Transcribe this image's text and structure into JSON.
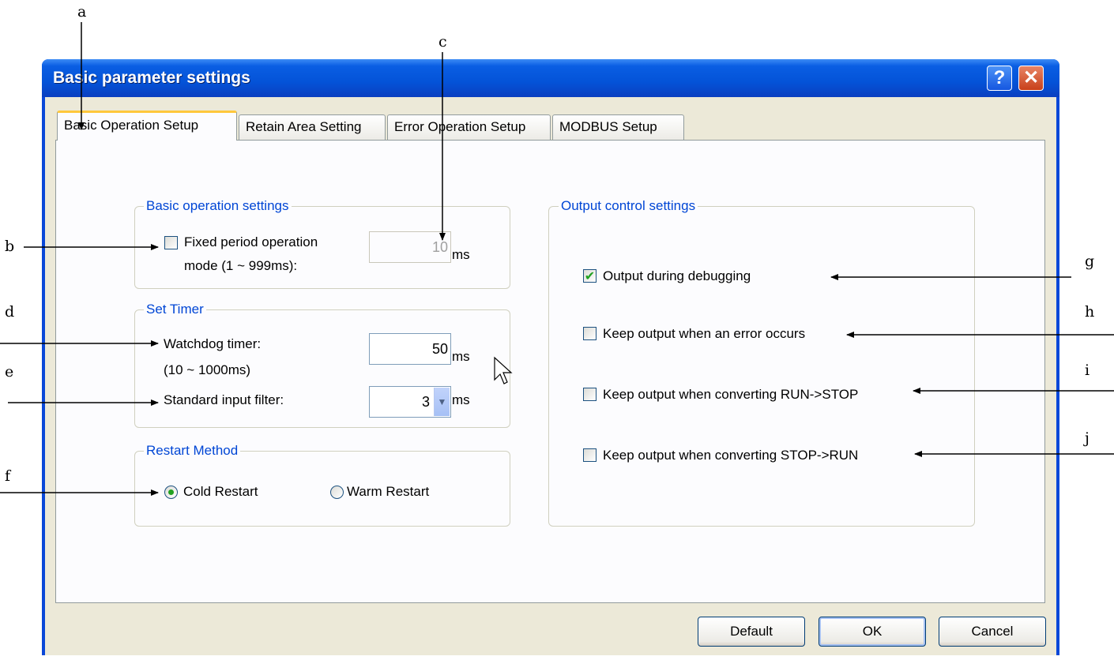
{
  "window": {
    "title": "Basic parameter settings",
    "help_glyph": "?",
    "close_glyph": "✕"
  },
  "tabs": [
    {
      "label": "Basic Operation Setup",
      "active": true
    },
    {
      "label": "Retain Area Setting"
    },
    {
      "label": "Error Operation Setup"
    },
    {
      "label": "MODBUS Setup"
    }
  ],
  "basic_operation": {
    "legend": "Basic operation settings",
    "fixed_period_label_1": "Fixed period operation",
    "fixed_period_label_2": "mode (1 ~ 999ms):",
    "fixed_period_checked": false,
    "fixed_period_value": "10",
    "unit": "ms"
  },
  "set_timer": {
    "legend": "Set Timer",
    "watchdog_label_1": "Watchdog timer:",
    "watchdog_label_2": "(10 ~ 1000ms)",
    "watchdog_value": "50",
    "filter_label": "Standard input filter:",
    "filter_value": "3",
    "unit": "ms"
  },
  "restart": {
    "legend": "Restart Method",
    "cold_label": "Cold Restart",
    "warm_label": "Warm Restart",
    "selected": "cold"
  },
  "output_control": {
    "legend": "Output control settings",
    "items": [
      {
        "label": "Output during debugging",
        "checked": true
      },
      {
        "label": "Keep output when an error occurs",
        "checked": false
      },
      {
        "label": "Keep output when converting RUN->STOP",
        "checked": false
      },
      {
        "label": "Keep output when converting STOP->RUN",
        "checked": false
      }
    ]
  },
  "buttons": {
    "default_label": "Default",
    "ok_label": "OK",
    "cancel_label": "Cancel"
  },
  "callouts": {
    "a": "a",
    "b": "b",
    "c": "c",
    "d": "d",
    "e": "e",
    "f": "f",
    "g": "g",
    "h": "h",
    "i": "i",
    "j": "j"
  },
  "colors": {
    "title_bar": "#0453d8",
    "dialog_face": "#ece9d8",
    "group_legend": "#0046d5",
    "check_mark": "#21a121",
    "active_tab_accent": "#ffc83c"
  }
}
